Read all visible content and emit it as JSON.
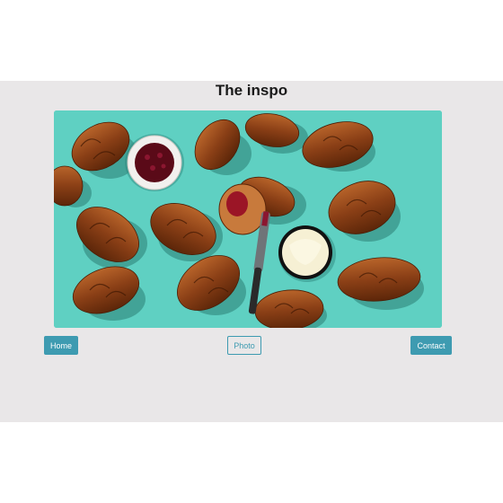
{
  "page": {
    "title": "The inspo"
  },
  "nav": {
    "home_label": "Home",
    "photo_label": "Photo",
    "contact_label": "Contact"
  },
  "colors": {
    "accent": "#3e9bb1",
    "page_band": "#e9e7e8",
    "photo_background": "#5fd0c2"
  },
  "hero": {
    "subject": "croissants-with-jam-and-butter"
  }
}
